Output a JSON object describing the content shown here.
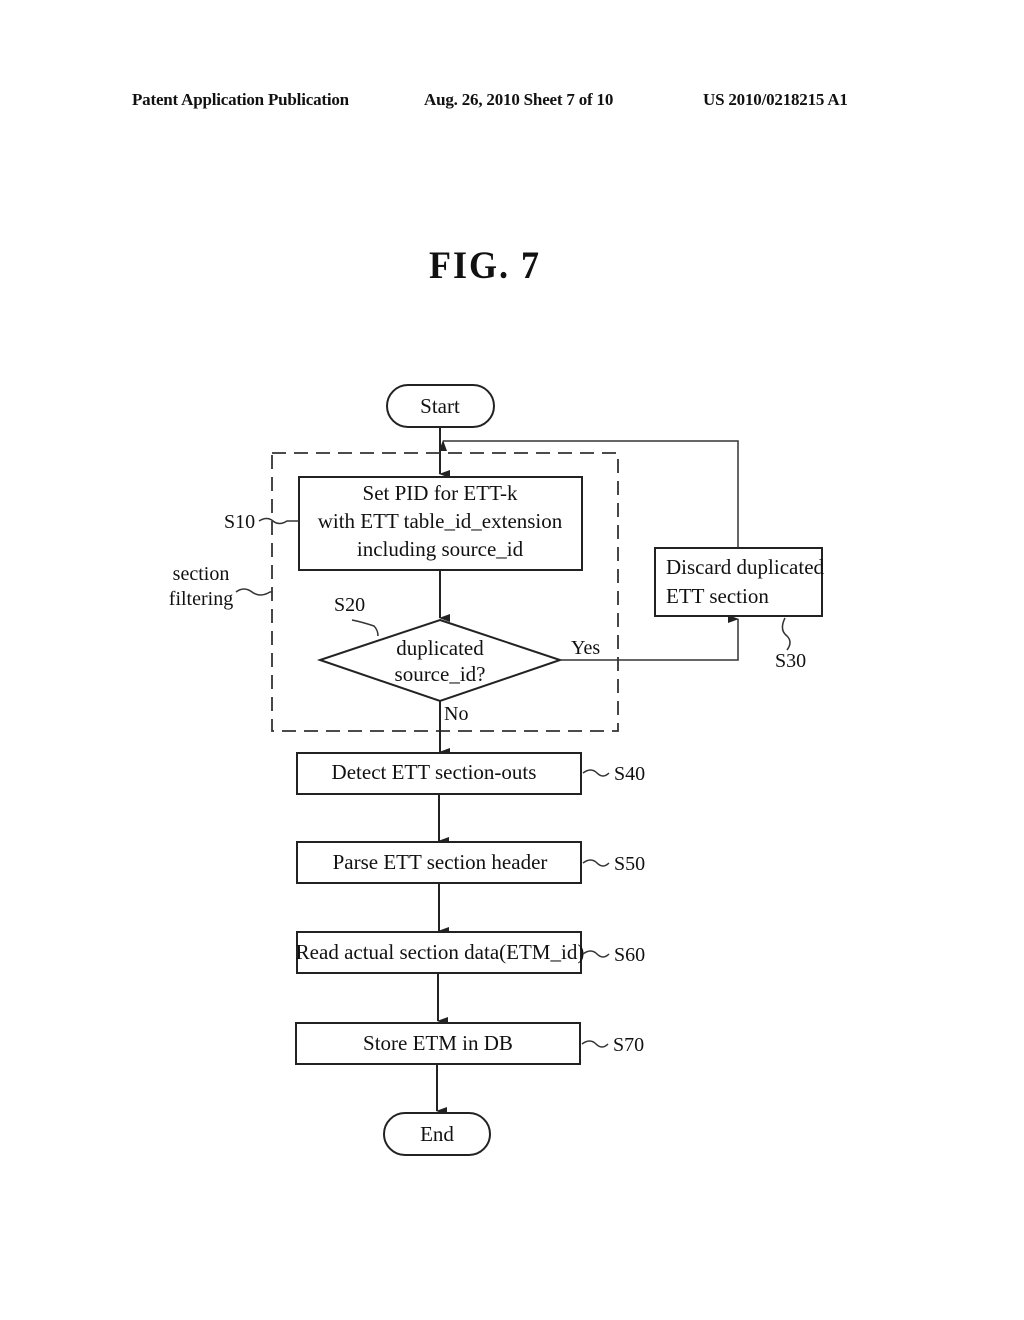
{
  "header": {
    "left": "Patent Application Publication",
    "middle": "Aug. 26, 2010  Sheet 7 of 10",
    "right": "US 2010/0218215 A1"
  },
  "figure": {
    "title": "FIG. 7"
  },
  "flowchart": {
    "start": "Start",
    "end": "End",
    "group": {
      "label_line1": "section",
      "label_line2": "filtering"
    },
    "steps": {
      "s10": {
        "id": "S10",
        "lines": [
          "Set PID for ETT-k",
          "with ETT table_id_extension",
          "including source_id"
        ]
      },
      "s20": {
        "id": "S20",
        "lines": [
          "duplicated",
          "source_id?"
        ],
        "yes": "Yes",
        "no": "No"
      },
      "s30": {
        "id": "S30",
        "lines": [
          "Discard duplicated",
          "ETT section"
        ]
      },
      "s40": {
        "id": "S40",
        "text": "Detect ETT section-outs"
      },
      "s50": {
        "id": "S50",
        "text": "Parse ETT section header"
      },
      "s60": {
        "id": "S60",
        "text": "Read actual section data(ETM_id)"
      },
      "s70": {
        "id": "S70",
        "text": "Store ETM in DB"
      }
    }
  }
}
